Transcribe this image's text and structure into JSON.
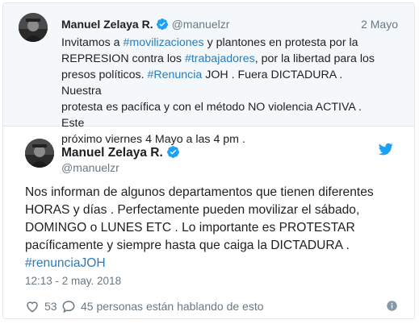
{
  "quoted": {
    "name": "Manuel Zelaya R.",
    "handle": "@manuelzr",
    "date": "2 Mayo",
    "line1_pre": "Invitamos a  ",
    "line1_tag": "#movilizaciones",
    "line1_post": " y plantones en protesta por la",
    "line2_pre": "REPRESION contra los ",
    "line2_tag": "#trabajadores",
    "line2_post": ", por la libertad para los",
    "line3": "presos políticos. ",
    "line3_tag": "#Renuncia",
    "line3_post": " JOH . Fuera DICTADURA . Nuestra",
    "line4": "protesta es pacífica y con el método NO violencia ACTIVA . Este",
    "line5": "próximo viernes 4 Mayo a las 4 pm ."
  },
  "tweet": {
    "name": "Manuel Zelaya R.",
    "handle": "@manuelzr",
    "line1": "Nos informan de algunos departamentos que tienen diferentes",
    "line2": "HORAS y días . Perfectamente pueden movilizar el sábado,",
    "line3": "DOMINGO o LUNES ETC . Lo importante es PROTESTAR",
    "line4": "pacíficamente y siempre hasta que caiga la DICTADURA .",
    "hashtag": "#renunciaJOH",
    "timestamp": "12:13 - 2 may. 2018",
    "likes": "53",
    "replies_text": "45 personas están hablando de esto"
  },
  "icons": {
    "verified": "verified-badge-icon",
    "twitter": "twitter-bird-icon",
    "like": "heart-icon",
    "reply": "comment-bubble-icon",
    "info": "info-icon"
  },
  "colors": {
    "link": "#2b7bb9",
    "verified": "#1da1f2",
    "muted": "#697882",
    "quoted_bg": "#f5f8fa"
  }
}
